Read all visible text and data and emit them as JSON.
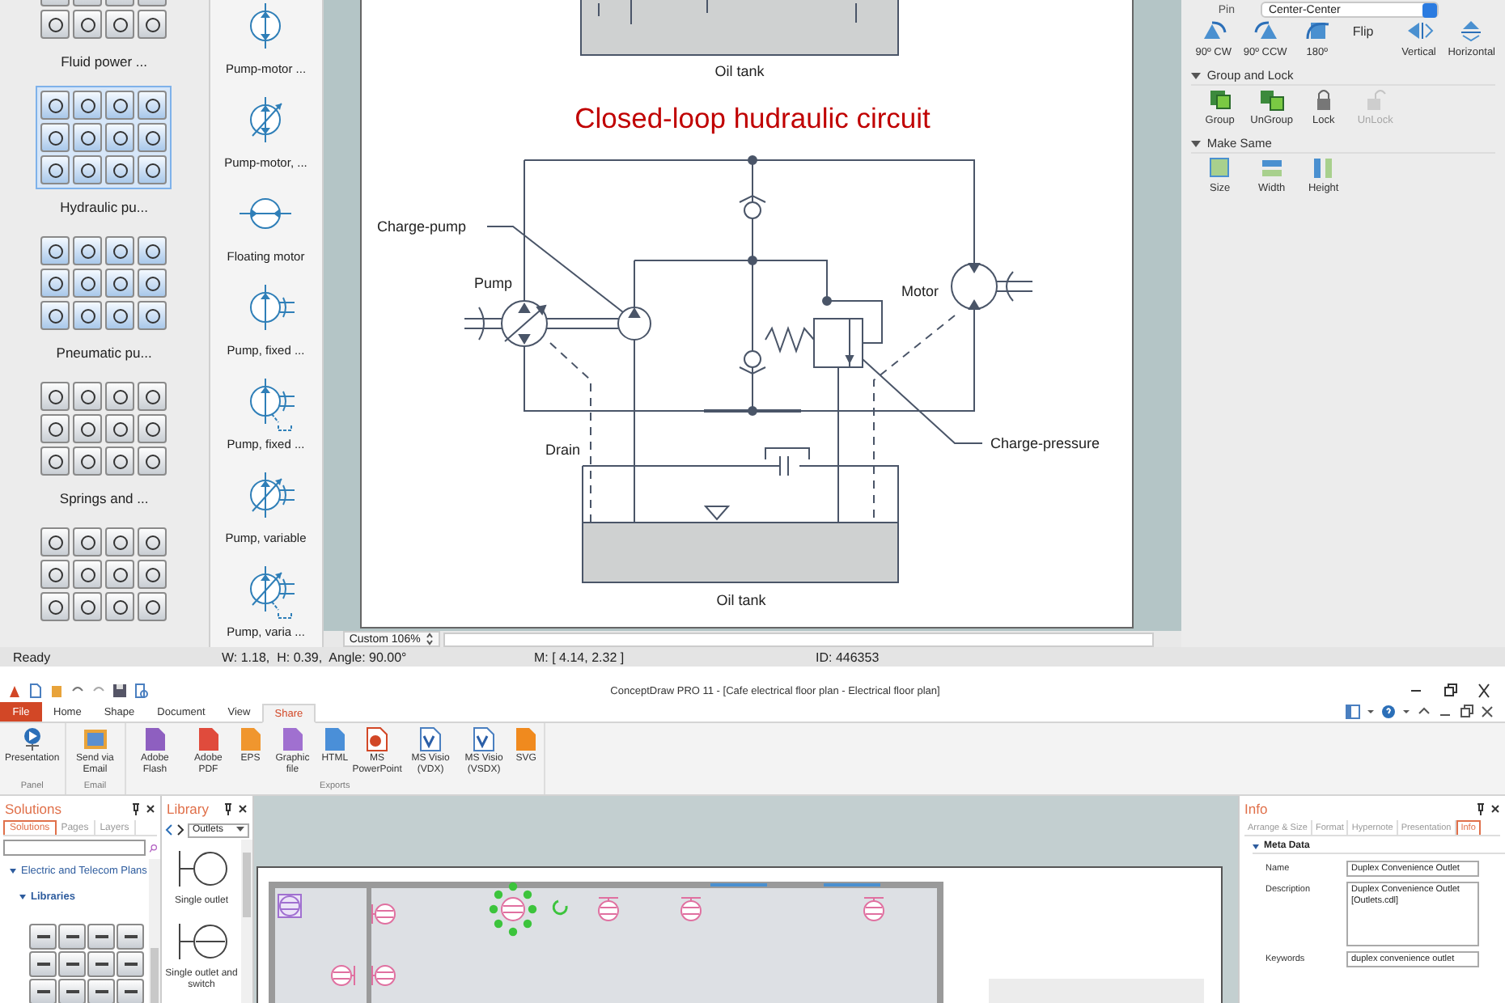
{
  "top_window": {
    "library_groups": [
      {
        "label": "Fluid power ...",
        "selected": false
      },
      {
        "label": "Hydraulic pu...",
        "selected": true
      },
      {
        "label": "Pneumatic pu...",
        "selected": false
      },
      {
        "label": "Springs and ...",
        "selected": false
      },
      {
        "selected": false
      }
    ],
    "shapes": [
      {
        "label": "Pump-motor ...",
        "kind": "reversible"
      },
      {
        "label": "Pump-motor, ...",
        "kind": "reversible-variable"
      },
      {
        "label": "Floating motor",
        "kind": "floating"
      },
      {
        "label": "Pump, fixed ...",
        "kind": "fixed"
      },
      {
        "label": "Pump, fixed ...",
        "kind": "fixed-drain"
      },
      {
        "label": "Pump, variable",
        "kind": "variable"
      },
      {
        "label": "Pump, varia ...",
        "kind": "variable-drain"
      }
    ],
    "diagram": {
      "top_tank_label": "Oil tank",
      "title": "Closed-loop hudraulic circuit",
      "charge_pump_label": "Charge-pump",
      "pump_label": "Pump",
      "motor_label": "Motor",
      "drain_label": "Drain",
      "charge_pressure_label": "Charge-pressure",
      "tank_label": "Oil tank"
    },
    "zoom": "Custom 106%",
    "properties": {
      "pin_label": "Pin",
      "pin_value": "Center-Center",
      "rotate": [
        {
          "label": "90º CW",
          "kind": "cw"
        },
        {
          "label": "90º CCW",
          "kind": "ccw"
        },
        {
          "label": "180º",
          "kind": "half"
        }
      ],
      "flip_label": "Flip",
      "flip": [
        {
          "label": "Vertical",
          "kind": "vertical"
        },
        {
          "label": "Horizontal",
          "kind": "horizontal"
        }
      ],
      "sections": [
        {
          "title": "Group and Lock",
          "expanded": true,
          "buttons": [
            {
              "label": "Group",
              "kind": "group",
              "disabled": false
            },
            {
              "label": "UnGroup",
              "kind": "ungroup",
              "disabled": false
            },
            {
              "label": "Lock",
              "kind": "lock",
              "disabled": false
            },
            {
              "label": "UnLock",
              "kind": "unlock",
              "disabled": true
            }
          ]
        },
        {
          "title": "Make Same",
          "expanded": true,
          "buttons": [
            {
              "label": "Size",
              "kind": "size",
              "disabled": false
            },
            {
              "label": "Width",
              "kind": "width",
              "disabled": false
            },
            {
              "label": "Height",
              "kind": "height",
              "disabled": false
            }
          ]
        }
      ]
    },
    "status_bar": [
      "Ready",
      "W: 1.18,  H: 0.39,  Angle: 90.00°",
      "M: [ 4.14, 2.32 ]",
      "ID: 446353"
    ]
  },
  "bottom_window": {
    "title": "ConceptDraw PRO 11 - [Cafe electrical floor plan - Electrical floor plan]",
    "tabs": [
      {
        "label": "File",
        "kind": "file",
        "selected": false
      },
      {
        "label": "Home",
        "kind": "tab",
        "selected": false
      },
      {
        "label": "Shape",
        "kind": "tab",
        "selected": false
      },
      {
        "label": "Document",
        "kind": "tab",
        "selected": false
      },
      {
        "label": "View",
        "kind": "tab",
        "selected": false
      },
      {
        "label": "Share",
        "kind": "tab",
        "selected": true
      }
    ],
    "ribbon_groups": [
      {
        "label": "Panel",
        "buttons": [
          {
            "label": "Presentation",
            "kind": "presentation"
          }
        ]
      },
      {
        "label": "Email",
        "buttons": [
          {
            "label": "Send via Email",
            "kind": "email"
          }
        ]
      },
      {
        "label": "Exports",
        "buttons": [
          {
            "label": "Adobe Flash",
            "kind": "flash"
          },
          {
            "label": "Adobe PDF",
            "kind": "pdf"
          },
          {
            "label": "EPS",
            "kind": "eps"
          },
          {
            "label": "Graphic file",
            "kind": "graphic"
          },
          {
            "label": "HTML",
            "kind": "html"
          },
          {
            "label": "MS PowerPoint",
            "kind": "ppt"
          },
          {
            "label": "MS Visio (VDX)",
            "kind": "visio"
          },
          {
            "label": "MS Visio (VSDX)",
            "kind": "visio"
          },
          {
            "label": "SVG",
            "kind": "svg"
          }
        ]
      }
    ],
    "solutions_panel": {
      "title": "Solutions",
      "tabs": [
        {
          "label": "Solutions",
          "selected": true
        },
        {
          "label": "Pages",
          "selected": false
        },
        {
          "label": "Layers",
          "selected": false
        }
      ],
      "tree": [
        {
          "label": "Electric and Telecom Plans",
          "expanded": true,
          "children": [
            {
              "label": "Libraries",
              "expanded": true
            }
          ]
        }
      ]
    },
    "library_panel": {
      "title": "Library",
      "dropdown": "Outlets",
      "items": [
        {
          "label": "Single outlet",
          "kind": "outlet"
        },
        {
          "label": "Single outlet and switch",
          "kind": "outlet-switch"
        }
      ]
    },
    "info_panel": {
      "title": "Info",
      "tabs": [
        {
          "label": "Arrange & Size",
          "selected": false
        },
        {
          "label": "Format",
          "selected": false
        },
        {
          "label": "Hypernote",
          "selected": false
        },
        {
          "label": "Presentation",
          "selected": false
        },
        {
          "label": "Info",
          "selected": true
        }
      ],
      "section": "Meta Data",
      "fields": [
        {
          "label": "Name",
          "value": "Duplex Convenience Outlet",
          "kind": "line"
        },
        {
          "label": "Description",
          "value": "Duplex Convenience Outlet [Outlets.cdl]",
          "kind": "area"
        },
        {
          "label": "Keywords",
          "value": "duplex convenience outlet",
          "kind": "line"
        }
      ]
    }
  }
}
